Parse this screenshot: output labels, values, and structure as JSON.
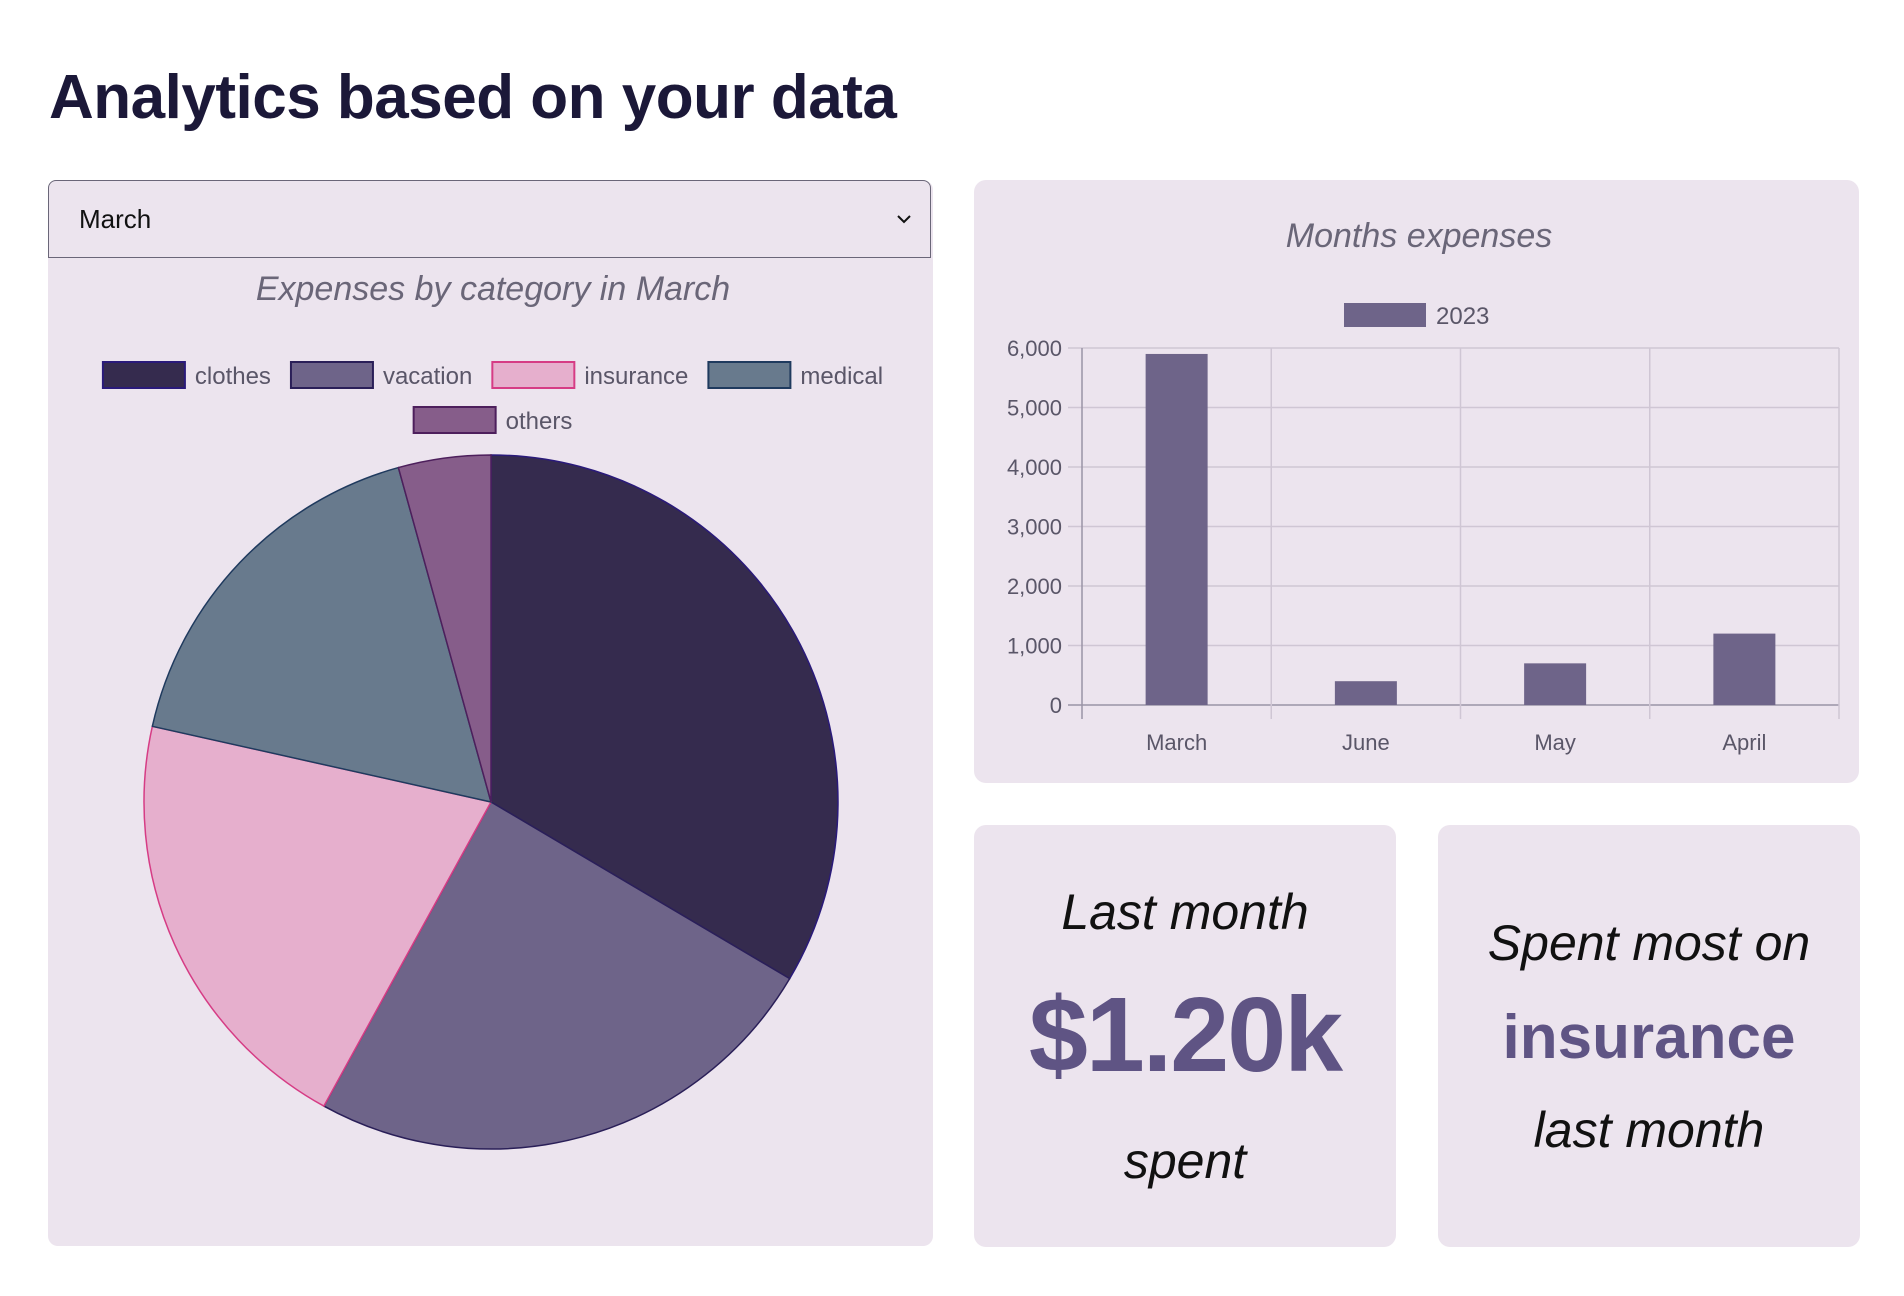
{
  "page": {
    "title": "Analytics based on your data"
  },
  "month_select": {
    "selected": "March",
    "icon": "chevron-down-icon"
  },
  "pie_chart": {
    "title": "Expenses by category in March",
    "chart_data": {
      "type": "pie",
      "title": "Expenses by category in March",
      "categories": [
        "clothes",
        "vacation",
        "insurance",
        "medical",
        "others"
      ],
      "values": [
        33.5,
        24.5,
        20.5,
        17.2,
        4.3
      ],
      "colors": [
        "#352b4e",
        "#6e6489",
        "#e6afcd",
        "#687a8d",
        "#865d8a"
      ],
      "borders": [
        "#2a1a7a",
        "#2a1f58",
        "#d63c85",
        "#1f3a5e",
        "#4d1f5c"
      ],
      "legend": "top"
    }
  },
  "bar_chart": {
    "title": "Months expenses",
    "chart_data": {
      "type": "bar",
      "title": "Months expenses",
      "categories": [
        "March",
        "June",
        "May",
        "April"
      ],
      "series": [
        {
          "name": "2023",
          "values": [
            5900,
            400,
            700,
            1200
          ]
        }
      ],
      "ylim": [
        0,
        6000
      ],
      "yticks": [
        "0",
        "1,000",
        "2,000",
        "3,000",
        "4,000",
        "5,000",
        "6,000"
      ],
      "bar_color": "#6e6489",
      "grid": true,
      "legend": "top"
    }
  },
  "stat_last": {
    "top": "Last month",
    "value": "$1.20k",
    "bottom": "spent"
  },
  "stat_most": {
    "top": "Spent most on",
    "value": "insurance",
    "bottom": "last month"
  }
}
